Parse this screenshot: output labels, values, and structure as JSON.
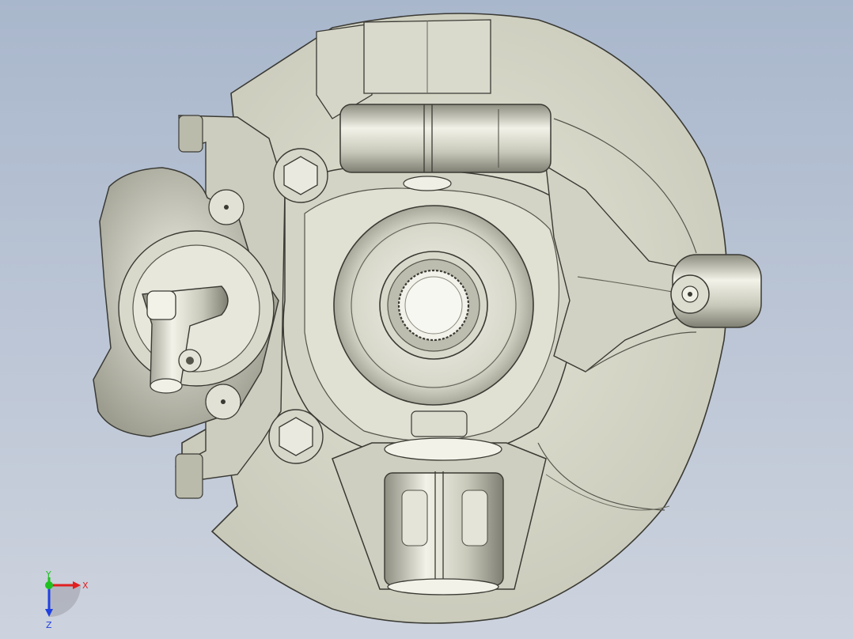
{
  "viewport": {
    "background_top": "#a9b7cc",
    "background_bottom": "#cdd3de",
    "model": "steering-knuckle-brake-assembly"
  },
  "triad": {
    "x_label": "X",
    "y_label": "Y",
    "z_label": "Z",
    "x_color": "#e02020",
    "y_color": "#20c020",
    "z_color": "#2040e0"
  },
  "colors": {
    "metal_light": "#e8e8dc",
    "metal_mid": "#c7c7b8",
    "metal_dark": "#8e8e80",
    "edge": "#3a3a34"
  }
}
